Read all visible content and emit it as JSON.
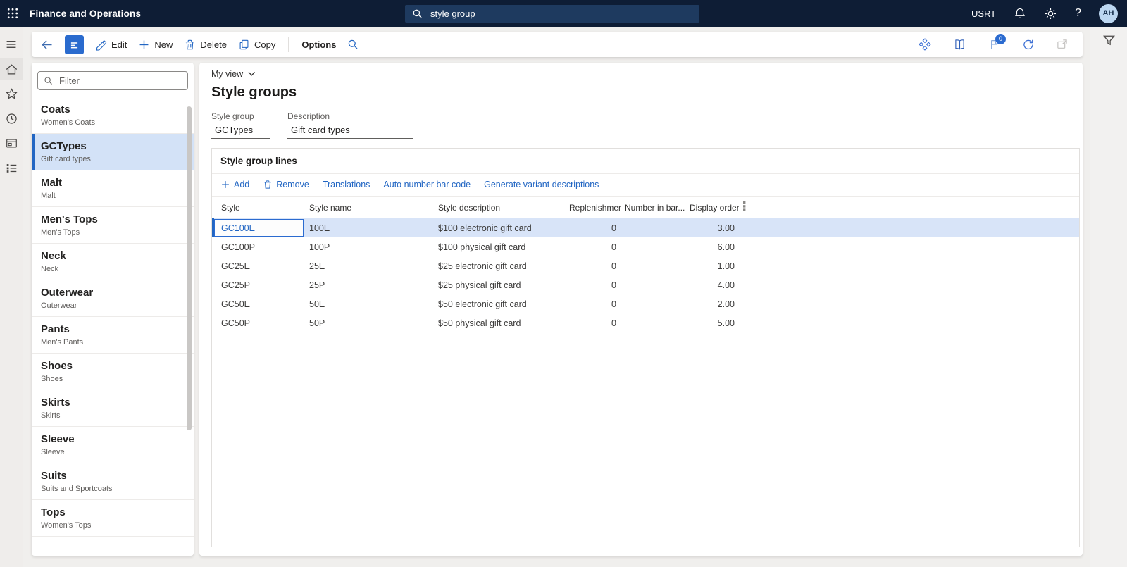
{
  "topbar": {
    "app_title": "Finance and Operations",
    "search_value": "style group",
    "environment": "USRT",
    "avatar_initials": "AH",
    "help_label": "?"
  },
  "action_bar": {
    "edit_label": "Edit",
    "new_label": "New",
    "delete_label": "Delete",
    "copy_label": "Copy",
    "options_label": "Options",
    "message_badge_count": "0"
  },
  "left_panel": {
    "filter_placeholder": "Filter",
    "items": [
      {
        "title": "Coats",
        "subtitle": "Women's Coats",
        "selected": false
      },
      {
        "title": "GCTypes",
        "subtitle": "Gift card types",
        "selected": true
      },
      {
        "title": "Malt",
        "subtitle": "Malt",
        "selected": false
      },
      {
        "title": "Men's Tops",
        "subtitle": "Men's Tops",
        "selected": false
      },
      {
        "title": "Neck",
        "subtitle": "Neck",
        "selected": false
      },
      {
        "title": "Outerwear",
        "subtitle": "Outerwear",
        "selected": false
      },
      {
        "title": "Pants",
        "subtitle": "Men's Pants",
        "selected": false
      },
      {
        "title": "Shoes",
        "subtitle": "Shoes",
        "selected": false
      },
      {
        "title": "Skirts",
        "subtitle": "Skirts",
        "selected": false
      },
      {
        "title": "Sleeve",
        "subtitle": "Sleeve",
        "selected": false
      },
      {
        "title": "Suits",
        "subtitle": "Suits and Sportcoats",
        "selected": false
      },
      {
        "title": "Tops",
        "subtitle": "Women's Tops",
        "selected": false
      }
    ]
  },
  "main": {
    "view_selector": "My view",
    "page_title": "Style groups",
    "fields": [
      {
        "label": "Style group",
        "value": "GCTypes"
      },
      {
        "label": "Description",
        "value": "Gift card types"
      }
    ],
    "section": {
      "title": "Style group lines",
      "actions": [
        "Add",
        "Remove",
        "Translations",
        "Auto number bar code",
        "Generate variant descriptions"
      ],
      "grid": {
        "columns": [
          "Style",
          "Style name",
          "Style description",
          "Replenishment...",
          "Number in bar...",
          "Display order"
        ],
        "rows": [
          {
            "style": "GC100E",
            "style_name": "100E",
            "description": "$100 electronic gift card",
            "replenishment": "0",
            "number_in_bar": "",
            "display_order": "3.00",
            "selected": true
          },
          {
            "style": "GC100P",
            "style_name": "100P",
            "description": "$100 physical gift card",
            "replenishment": "0",
            "number_in_bar": "",
            "display_order": "6.00",
            "selected": false
          },
          {
            "style": "GC25E",
            "style_name": "25E",
            "description": "$25 electronic gift card",
            "replenishment": "0",
            "number_in_bar": "",
            "display_order": "1.00",
            "selected": false
          },
          {
            "style": "GC25P",
            "style_name": "25P",
            "description": "$25 physical gift card",
            "replenishment": "0",
            "number_in_bar": "",
            "display_order": "4.00",
            "selected": false
          },
          {
            "style": "GC50E",
            "style_name": "50E",
            "description": "$50 electronic gift card",
            "replenishment": "0",
            "number_in_bar": "",
            "display_order": "2.00",
            "selected": false
          },
          {
            "style": "GC50P",
            "style_name": "50P",
            "description": "$50 physical gift card",
            "replenishment": "0",
            "number_in_bar": "",
            "display_order": "5.00",
            "selected": false
          }
        ]
      }
    }
  },
  "colors": {
    "topbar_bg": "#0e1d35",
    "accent_blue": "#2266c3",
    "selected_row_bg": "#d8e4f8",
    "selected_item_bg": "#d3e2f7",
    "avatar_bg": "#bcd7f1"
  }
}
